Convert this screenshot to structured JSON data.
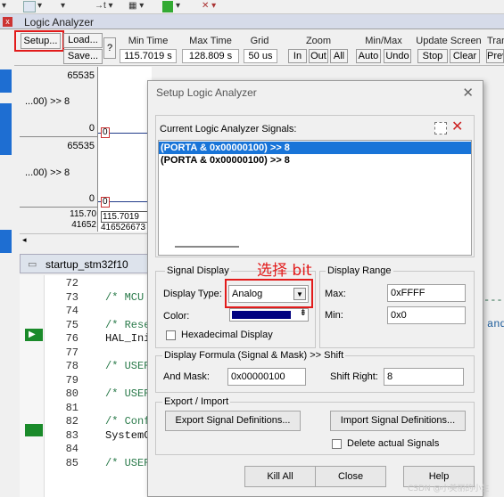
{
  "window": {
    "title": "Logic Analyzer"
  },
  "toolbar": {
    "setup_label": "Setup...",
    "load_label": "Load...",
    "save_label": "Save...",
    "help_label": "?",
    "min_time_header": "Min Time",
    "min_time": "115.7019 s",
    "max_time_header": "Max Time",
    "max_time": "128.809 s",
    "grid_header": "Grid",
    "grid": "50 us",
    "zoom_header": "Zoom",
    "zoom_in": "In",
    "zoom_out": "Out",
    "zoom_all": "All",
    "minmax_header": "Min/Max",
    "auto": "Auto",
    "undo": "Undo",
    "update_header": "Update Screen",
    "stop": "Stop",
    "clear": "Clear",
    "trans_header": "Tran",
    "prev": "Prev"
  },
  "plot": {
    "sig1": {
      "max": "65535",
      "name": "...00) >> 8",
      "min": "0"
    },
    "sig2": {
      "max": "65535",
      "name": "...00) >> 8",
      "min": "0"
    },
    "time1": "115.70",
    "time2": "41652",
    "marker1": "0",
    "marker2": "0",
    "time_box1": "115.7019",
    "time_box2": "416526673"
  },
  "editor": {
    "tab": "startup_stm32f10",
    "lines": [
      {
        "n": "72",
        "code": ""
      },
      {
        "n": "73",
        "code": "/* MCU"
      },
      {
        "n": "74",
        "code": ""
      },
      {
        "n": "75",
        "code": "/* Rese"
      },
      {
        "n": "76",
        "code": "HAL_Ini"
      },
      {
        "n": "77",
        "code": ""
      },
      {
        "n": "78",
        "code": "/* USER"
      },
      {
        "n": "79",
        "code": ""
      },
      {
        "n": "80",
        "code": "/* USER"
      },
      {
        "n": "81",
        "code": ""
      },
      {
        "n": "82",
        "code": "/* Conf"
      },
      {
        "n": "83",
        "code": "SystemC"
      },
      {
        "n": "84",
        "code": ""
      },
      {
        "n": "85",
        "code": "/* USER"
      }
    ],
    "right_word": "and"
  },
  "dialog": {
    "title": "Setup Logic Analyzer",
    "signals_label": "Current Logic Analyzer Signals:",
    "signals": [
      "(PORTA & 0x00000100) >> 8",
      "(PORTA & 0x00000100) >> 8"
    ],
    "signal_display_label": "Signal Display",
    "annotation": "选择 bit",
    "display_type_label": "Display Type:",
    "display_type": "Analog",
    "color_label": "Color:",
    "color": "#000080",
    "hex_label": "Hexadecimal Display",
    "display_range_label": "Display Range",
    "max_label": "Max:",
    "max": "0xFFFF",
    "min_label": "Min:",
    "min": "0x0",
    "formula_label": "Display Formula (Signal & Mask) >> Shift",
    "and_mask_label": "And Mask:",
    "and_mask": "0x00000100",
    "shift_label": "Shift Right:",
    "shift": "8",
    "export_import_label": "Export / Import",
    "export_btn": "Export Signal Definitions...",
    "import_btn": "Import Signal Definitions...",
    "delete_label": "Delete actual Signals",
    "kill_all": "Kill All",
    "close": "Close",
    "help": "Help"
  },
  "watermark": "CSDN @小美丽的小生"
}
